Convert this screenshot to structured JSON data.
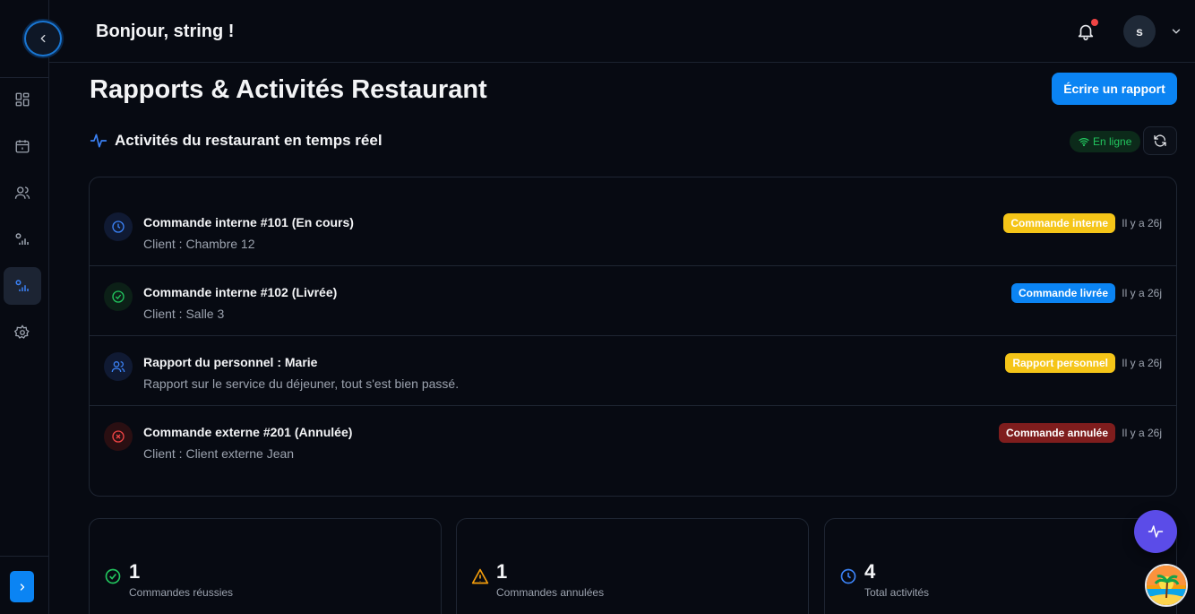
{
  "colors": {
    "accent": "#0b84f3",
    "background": "#070a12",
    "online": "#22c55e",
    "badge_yellow": "#f5c518",
    "badge_red": "#7f1d1d",
    "fab": "#5b4ce8"
  },
  "header": {
    "greeting": "Bonjour, string !",
    "avatar_initial": "s",
    "has_notification": true
  },
  "sidebar": {
    "items": [
      {
        "icon": "dashboard-icon",
        "active": false
      },
      {
        "icon": "calendar-icon",
        "active": false
      },
      {
        "icon": "users-icon",
        "active": false
      },
      {
        "icon": "reports-icon",
        "active": false
      },
      {
        "icon": "reports-icon",
        "active": true
      },
      {
        "icon": "gear-icon",
        "active": false
      }
    ]
  },
  "main": {
    "title": "Rapports & Activités Restaurant",
    "write_button": "Écrire un rapport",
    "section_title": "Activités du restaurant en temps réel",
    "status": "En ligne",
    "activities": [
      {
        "title": "Commande interne #101 (En cours)",
        "subtitle": "Client : Chambre 12",
        "badge": "Commande interne",
        "badge_color": "yellow",
        "time": "Il y a 26j",
        "icon": "clock-icon"
      },
      {
        "title": "Commande interne #102 (Livrée)",
        "subtitle": "Client : Salle 3",
        "badge": "Commande livrée",
        "badge_color": "blue",
        "time": "Il y a 26j",
        "icon": "check-circle-icon"
      },
      {
        "title": "Rapport du personnel : Marie",
        "subtitle": "Rapport sur le service du déjeuner, tout s'est bien passé.",
        "badge": "Rapport personnel",
        "badge_color": "yellow",
        "time": "Il y a 26j",
        "icon": "users-icon"
      },
      {
        "title": "Commande externe #201 (Annulée)",
        "subtitle": "Client : Client externe Jean",
        "badge": "Commande annulée",
        "badge_color": "red",
        "time": "Il y a 26j",
        "icon": "x-circle-icon"
      }
    ],
    "stats": [
      {
        "value": "1",
        "label": "Commandes réussies",
        "icon": "check-circle-icon"
      },
      {
        "value": "1",
        "label": "Commandes annulées",
        "icon": "warning-icon"
      },
      {
        "value": "4",
        "label": "Total activités",
        "icon": "clock-icon"
      }
    ]
  }
}
